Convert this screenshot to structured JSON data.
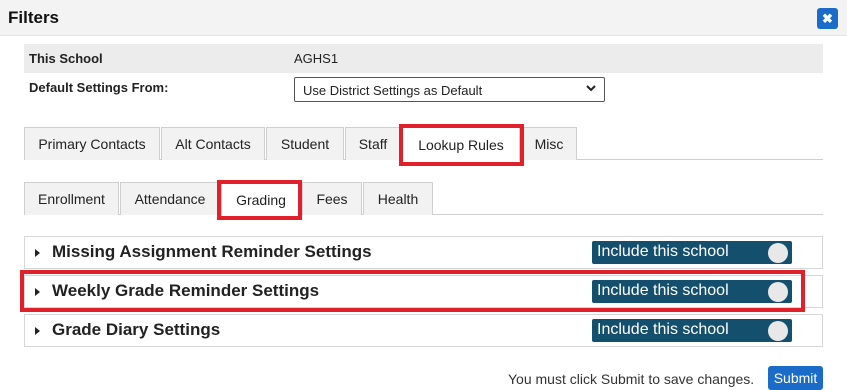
{
  "dialog": {
    "title": "Filters",
    "close_icon": "close-icon"
  },
  "info": {
    "school_label": "This School",
    "school_value": "AGHS1",
    "default_label": "Default Settings From:",
    "default_value": "Use District Settings as Default"
  },
  "tabs_main": [
    "Primary Contacts",
    "Alt Contacts",
    "Student",
    "Staff",
    "Lookup Rules",
    "Misc"
  ],
  "tabs_main_active": "Lookup Rules",
  "tabs_sub": [
    "Enrollment",
    "Attendance",
    "Grading",
    "Fees",
    "Health"
  ],
  "tabs_sub_active": "Grading",
  "sections": [
    {
      "title": "Missing Assignment Reminder Settings",
      "toggle_label": "Include this school"
    },
    {
      "title": "Weekly Grade Reminder Settings",
      "toggle_label": "Include this school"
    },
    {
      "title": "Grade Diary Settings",
      "toggle_label": "Include this school"
    }
  ],
  "footer": {
    "note": "You must click Submit to save changes.",
    "submit_label": "Submit"
  },
  "colors": {
    "accent": "#1a6cc8",
    "toggle": "#14506e",
    "highlight": "#e0202a"
  }
}
